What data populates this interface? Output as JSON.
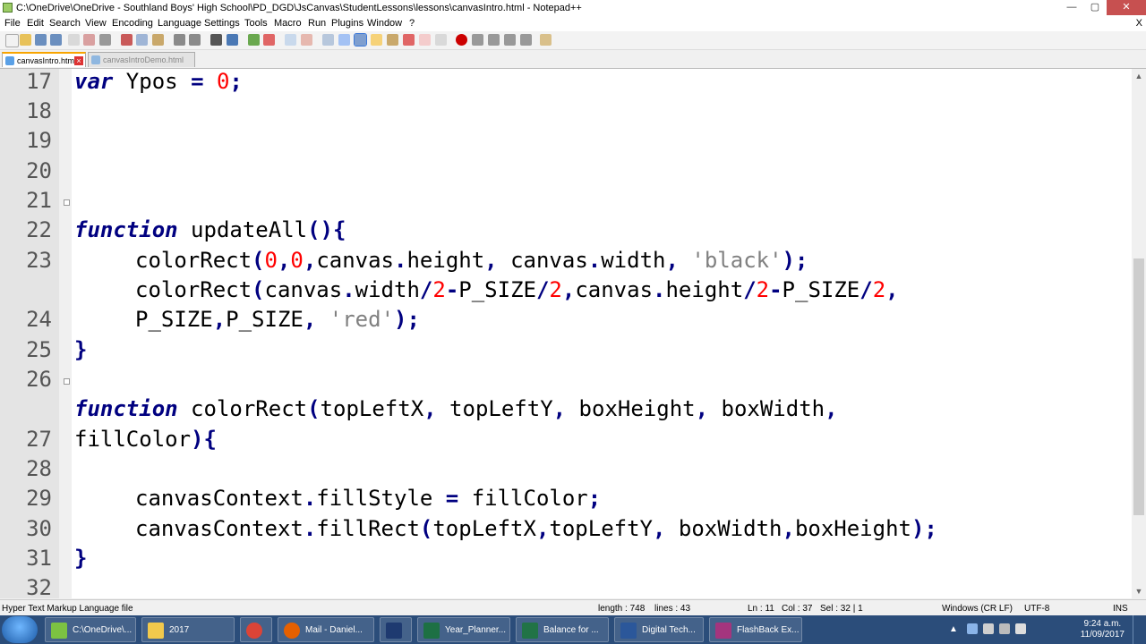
{
  "window": {
    "title": "C:\\OneDrive\\OneDrive - Southland Boys' High School\\PD_DGD\\JsCanvas\\StudentLessons\\lessons\\canvasIntro.html - Notepad++",
    "buttons": {
      "minimize": "—",
      "maximize": "▢",
      "close": "✕"
    }
  },
  "menu": {
    "items": [
      "File",
      "Edit",
      "Search",
      "View",
      "Encoding",
      "Language",
      "Settings",
      "Tools",
      "Macro",
      "Run",
      "Plugins",
      "Window",
      "?"
    ],
    "close_doc": "X"
  },
  "tabs": [
    {
      "label": "canvasIntro.html",
      "active": true
    },
    {
      "label": "canvasIntroDemo.html",
      "active": false
    }
  ],
  "editor": {
    "line_numbers": [
      "17",
      "18",
      "19",
      "20",
      "21",
      "22",
      "23",
      "24",
      "25",
      "26",
      "27",
      "28",
      "29",
      "30",
      "31",
      "32"
    ],
    "lines": [
      "var Ypos = 0;",
      "function updateAll(){",
      "colorRect(0,0,canvas.height, canvas.width, 'black');",
      "colorRect(canvas.width/2-P_SIZE/2,canvas.height/2-P_SIZE/2,",
      "P_SIZE,P_SIZE, 'red');",
      "}",
      "function colorRect(topLeftX, topLeftY, boxHeight, boxWidth,",
      "fillColor){",
      "canvasContext.fillStyle = fillColor;",
      "canvasContext.fillRect(topLeftX,topLeftY, boxWidth,boxHeight);",
      "}"
    ]
  },
  "status": {
    "file_type": "Hyper Text Markup Language file",
    "length": "length : 748",
    "lines": "lines : 43",
    "ln": "Ln : 11",
    "col": "Col : 37",
    "sel": "Sel : 32 | 1",
    "eol": "Windows (CR LF)",
    "encoding": "UTF-8",
    "mode": "INS"
  },
  "taskbar": {
    "buttons": [
      {
        "label": "C:\\OneDrive\\...",
        "icon": "notepadpp-icon",
        "color": "#7cc242"
      },
      {
        "label": "2017",
        "icon": "folder-icon",
        "color": "#f2c94c"
      },
      {
        "label": "",
        "icon": "chrome-icon",
        "color": "#db4437"
      },
      {
        "label": "Mail - Daniel...",
        "icon": "firefox-icon",
        "color": "#e66000"
      },
      {
        "label": "",
        "icon": "photoshop-icon",
        "color": "#1e3a70"
      },
      {
        "label": "Year_Planner...",
        "icon": "excel-icon",
        "color": "#1d7044"
      },
      {
        "label": "Balance for ...",
        "icon": "publisher-icon",
        "color": "#217346"
      },
      {
        "label": "Digital Tech...",
        "icon": "word-icon",
        "color": "#2b579a"
      },
      {
        "label": "FlashBack Ex...",
        "icon": "flashback-icon",
        "color": "#a4357e"
      }
    ],
    "time": "9:24 a.m.",
    "date": "11/09/2017"
  }
}
